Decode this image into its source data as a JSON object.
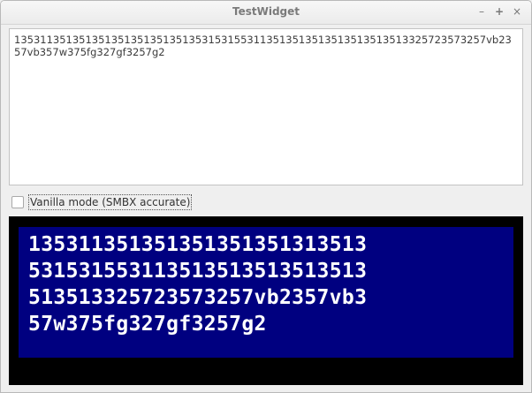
{
  "window": {
    "title": "TestWidget",
    "controls": {
      "minimize": "–",
      "maximize": "+",
      "close": "×"
    }
  },
  "editor": {
    "text": "1353113513513513513513513513531531553113513513513513513513513325723573257vb2357vb357w375fg327gf3257g2"
  },
  "options": {
    "vanilla_mode_label": "Vanilla mode (SMBX accurate)",
    "vanilla_mode_checked": false
  },
  "preview": {
    "lines": [
      "135311351351351351351313513",
      "531531553113513513513513513",
      "513513325723573257vb2357vb3",
      "57w375fg327gf3257g2"
    ],
    "colors": {
      "frame": "#000000",
      "box": "#000080",
      "text": "#ffffff"
    }
  }
}
